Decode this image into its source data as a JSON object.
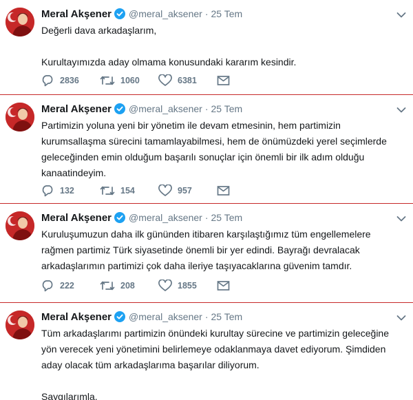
{
  "user": {
    "name": "Meral Akşener",
    "handle": "@meral_aksener"
  },
  "colors": {
    "separator": "#c62828",
    "verified": "#1da1f2",
    "muted": "#657786",
    "text": "#14171a"
  },
  "tweets": [
    {
      "date": "25 Tem",
      "paragraphs": [
        "Değerli dava arkadaşlarım,",
        "",
        "Kurultayımızda aday olmama konusundaki kararım kesindir."
      ],
      "replies": "2836",
      "retweets": "1060",
      "likes": "6381"
    },
    {
      "date": "25 Tem",
      "paragraphs": [
        "Partimizin yoluna yeni bir yönetim ile devam etmesinin, hem partimizin",
        "kurumsallaşma sürecini tamamlayabilmesi, hem de önümüzdeki yerel seçimlerde",
        "geleceğinden emin olduğum başarılı sonuçlar için önemli bir ilk adım olduğu",
        "kanaatindeyim."
      ],
      "replies": "132",
      "retweets": "154",
      "likes": "957"
    },
    {
      "date": "25 Tem",
      "paragraphs": [
        "Kuruluşumuzun daha ilk gününden itibaren karşılaştığımız tüm engellemelere",
        "rağmen partimiz Türk siyasetinde önemli bir yer edindi. Bayrağı devralacak",
        "arkadaşlarımın partimizi çok daha ileriye taşıyacaklarına güvenim tamdır."
      ],
      "replies": "222",
      "retweets": "208",
      "likes": "1855"
    },
    {
      "date": "25 Tem",
      "paragraphs": [
        "Tüm arkadaşlarımı partimizin önündeki kurultay sürecine ve partimizin geleceğine",
        "yön verecek yeni yönetimini belirlemeye odaklanmaya davet ediyorum. Şimdiden",
        "aday olacak tüm arkadaşlarıma başarılar diliyorum.",
        "",
        "Saygılarımla."
      ]
    }
  ]
}
